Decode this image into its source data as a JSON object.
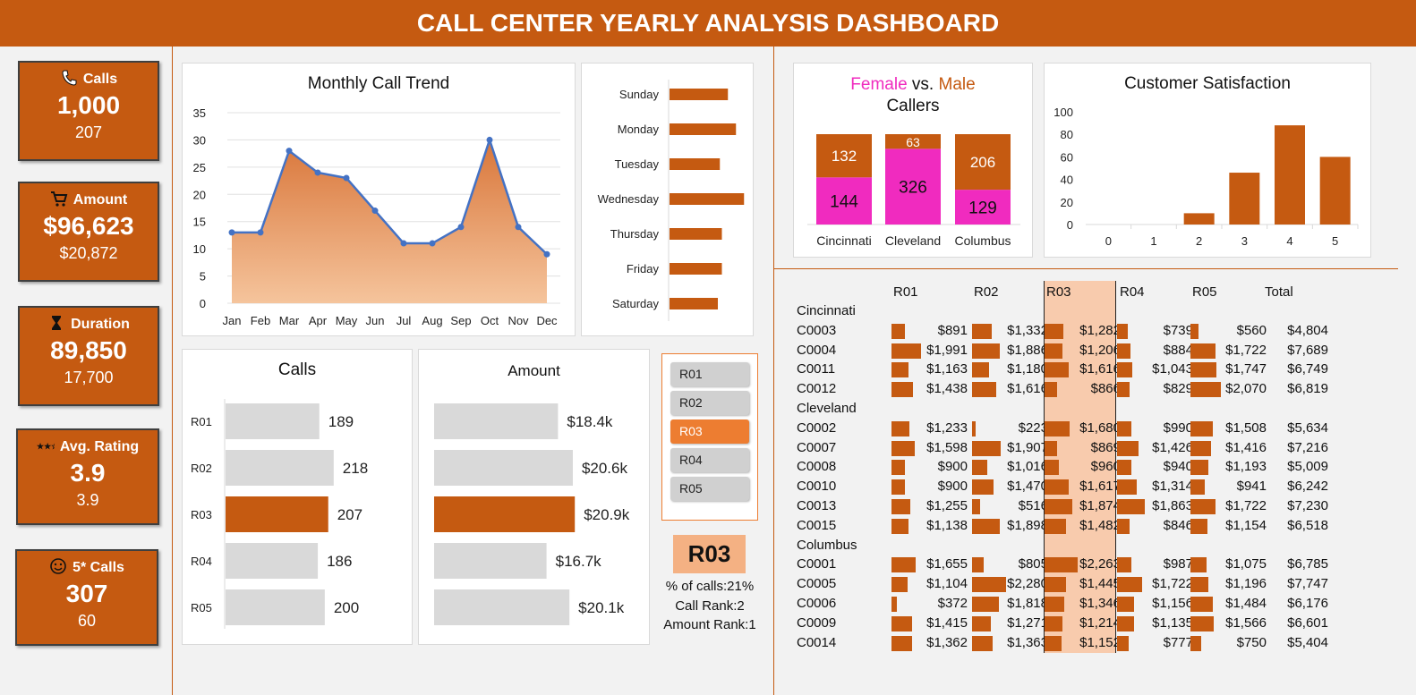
{
  "header": {
    "title": "CALL CENTER YEARLY ANALYSIS DASHBOARD"
  },
  "kpis": [
    {
      "label": "Calls",
      "icon": "phone-icon",
      "value": "1,000",
      "sub": "207"
    },
    {
      "label": "Amount",
      "icon": "cart-icon",
      "value": "$96,623",
      "sub": "$20,872"
    },
    {
      "label": "Duration",
      "icon": "hourglass-icon",
      "value": "89,850",
      "sub": "17,700"
    },
    {
      "label": "Avg. Rating",
      "icon": "stars-icon",
      "value": "3.9",
      "sub": "3.9"
    },
    {
      "label": "5* Calls",
      "icon": "smiley-icon",
      "value": "307",
      "sub": "60"
    }
  ],
  "charts": {
    "monthly": {
      "title": "Monthly Call Trend",
      "chart_data": {
        "type": "area",
        "categories": [
          "Jan",
          "Feb",
          "Mar",
          "Apr",
          "May",
          "Jun",
          "Jul",
          "Aug",
          "Sep",
          "Oct",
          "Nov",
          "Dec"
        ],
        "values": [
          13,
          13,
          28,
          24,
          23,
          17,
          11,
          11,
          14,
          30,
          14,
          9
        ],
        "yticks": [
          "0",
          "5",
          "10",
          "15",
          "20",
          "25",
          "30",
          "35"
        ],
        "ylim": [
          0,
          35
        ]
      }
    },
    "weekday": {
      "chart_data": {
        "type": "bar",
        "categories": [
          "Sunday",
          "Monday",
          "Tuesday",
          "Wednesday",
          "Thursday",
          "Friday",
          "Saturday"
        ],
        "values": [
          29,
          33,
          25,
          37,
          26,
          26,
          24
        ],
        "xlim": [
          0,
          40
        ]
      }
    },
    "gender": {
      "title_female": "Female",
      "title_vs": " vs. ",
      "title_male": "Male",
      "title_line2": "Callers",
      "chart_data": {
        "type": "bar",
        "stacked": true,
        "categories": [
          "Cincinnati",
          "Cleveland",
          "Columbus"
        ],
        "series": [
          {
            "name": "Female",
            "values": [
              144,
              326,
              129
            ]
          },
          {
            "name": "Male",
            "values": [
              132,
              63,
              206
            ]
          }
        ],
        "labels": [
          [
            "144",
            "132"
          ],
          [
            "326",
            "63"
          ],
          [
            "129",
            "206"
          ]
        ],
        "female_color": "#f02bbf",
        "male_color": "#c55a11"
      }
    },
    "satisfaction": {
      "title": "Customer Satisfaction",
      "chart_data": {
        "type": "bar",
        "categories": [
          "0",
          "1",
          "2",
          "3",
          "4",
          "5"
        ],
        "values": [
          0,
          0,
          10,
          46,
          88,
          60
        ],
        "yticks": [
          "0",
          "20",
          "40",
          "60",
          "80",
          "100"
        ],
        "ylim": [
          0,
          100
        ]
      }
    },
    "calls_rep": {
      "title": "Calls",
      "chart_data": {
        "type": "bar",
        "categories": [
          "R01",
          "R02",
          "R03",
          "R04",
          "R05"
        ],
        "values": [
          189,
          218,
          207,
          186,
          200
        ],
        "labels": [
          "189",
          "218",
          "207",
          "186",
          "200"
        ],
        "highlight": "R03",
        "xlim": [
          0,
          240
        ]
      }
    },
    "amount_rep": {
      "title": "Amount",
      "chart_data": {
        "type": "bar",
        "categories": [
          "R01",
          "R02",
          "R03",
          "R04",
          "R05"
        ],
        "values": [
          18.4,
          20.6,
          20.9,
          16.7,
          20.1
        ],
        "labels": [
          "$18.4k",
          "$20.6k",
          "$20.9k",
          "$16.7k",
          "$20.1k"
        ],
        "highlight": "R03",
        "xlim": [
          0,
          23
        ]
      }
    }
  },
  "slicer": {
    "items": [
      "R01",
      "R02",
      "R03",
      "R04",
      "R05"
    ],
    "selected": "R03"
  },
  "selected_info": {
    "rep": "R03",
    "pct": "% of calls:21%",
    "call_rank": "Call Rank:2",
    "amount_rank": "Amount Rank:1"
  },
  "table": {
    "headers": [
      "R01",
      "R02",
      "R03",
      "R04",
      "R05",
      "Total"
    ],
    "groups": [
      {
        "city": "Cincinnati",
        "rows": [
          {
            "id": "C0003",
            "vals": [
              "$891",
              "$1,332",
              "$1,282",
              "$739",
              "$560"
            ],
            "nums": [
              891,
              1332,
              1282,
              739,
              560
            ],
            "total": "$4,804"
          },
          {
            "id": "C0004",
            "vals": [
              "$1,991",
              "$1,886",
              "$1,206",
              "$884",
              "$1,722"
            ],
            "nums": [
              1991,
              1886,
              1206,
              884,
              1722
            ],
            "total": "$7,689"
          },
          {
            "id": "C0011",
            "vals": [
              "$1,163",
              "$1,180",
              "$1,616",
              "$1,043",
              "$1,747"
            ],
            "nums": [
              1163,
              1180,
              1616,
              1043,
              1747
            ],
            "total": "$6,749"
          },
          {
            "id": "C0012",
            "vals": [
              "$1,438",
              "$1,616",
              "$866",
              "$829",
              "$2,070"
            ],
            "nums": [
              1438,
              1616,
              866,
              829,
              2070
            ],
            "total": "$6,819"
          }
        ]
      },
      {
        "city": "Cleveland",
        "rows": [
          {
            "id": "C0002",
            "vals": [
              "$1,233",
              "$223",
              "$1,680",
              "$990",
              "$1,508"
            ],
            "nums": [
              1233,
              223,
              1680,
              990,
              1508
            ],
            "total": "$5,634"
          },
          {
            "id": "C0007",
            "vals": [
              "$1,598",
              "$1,907",
              "$869",
              "$1,426",
              "$1,416"
            ],
            "nums": [
              1598,
              1907,
              869,
              1426,
              1416
            ],
            "total": "$7,216"
          },
          {
            "id": "C0008",
            "vals": [
              "$900",
              "$1,016",
              "$960",
              "$940",
              "$1,193"
            ],
            "nums": [
              900,
              1016,
              960,
              940,
              1193
            ],
            "total": "$5,009"
          },
          {
            "id": "C0010",
            "vals": [
              "$900",
              "$1,470",
              "$1,617",
              "$1,314",
              "$941"
            ],
            "nums": [
              900,
              1470,
              1617,
              1314,
              941
            ],
            "total": "$6,242"
          },
          {
            "id": "C0013",
            "vals": [
              "$1,255",
              "$516",
              "$1,874",
              "$1,863",
              "$1,722"
            ],
            "nums": [
              1255,
              516,
              1874,
              1863,
              1722
            ],
            "total": "$7,230"
          },
          {
            "id": "C0015",
            "vals": [
              "$1,138",
              "$1,898",
              "$1,482",
              "$846",
              "$1,154"
            ],
            "nums": [
              1138,
              1898,
              1482,
              846,
              1154
            ],
            "total": "$6,518"
          }
        ]
      },
      {
        "city": "Columbus",
        "rows": [
          {
            "id": "C0001",
            "vals": [
              "$1,655",
              "$805",
              "$2,263",
              "$987",
              "$1,075"
            ],
            "nums": [
              1655,
              805,
              2263,
              987,
              1075
            ],
            "total": "$6,785"
          },
          {
            "id": "C0005",
            "vals": [
              "$1,104",
              "$2,280",
              "$1,445",
              "$1,722",
              "$1,196"
            ],
            "nums": [
              1104,
              2280,
              1445,
              1722,
              1196
            ],
            "total": "$7,747"
          },
          {
            "id": "C0006",
            "vals": [
              "$372",
              "$1,818",
              "$1,346",
              "$1,156",
              "$1,484"
            ],
            "nums": [
              372,
              1818,
              1346,
              1156,
              1484
            ],
            "total": "$6,176"
          },
          {
            "id": "C0009",
            "vals": [
              "$1,415",
              "$1,271",
              "$1,214",
              "$1,135",
              "$1,566"
            ],
            "nums": [
              1415,
              1271,
              1214,
              1135,
              1566
            ],
            "total": "$6,601"
          },
          {
            "id": "C0014",
            "vals": [
              "$1,362",
              "$1,363",
              "$1,152",
              "$777",
              "$750"
            ],
            "nums": [
              1362,
              1363,
              1152,
              777,
              750
            ],
            "total": "$5,404"
          }
        ]
      }
    ],
    "highlight_column": "R03"
  },
  "colors": {
    "accent": "#c55a11",
    "area_light": "#f5c49c",
    "line": "#4472c4",
    "highlight_col": "#f8cbad",
    "female": "#f02bbf",
    "grey_bar": "#d9d9d9"
  }
}
